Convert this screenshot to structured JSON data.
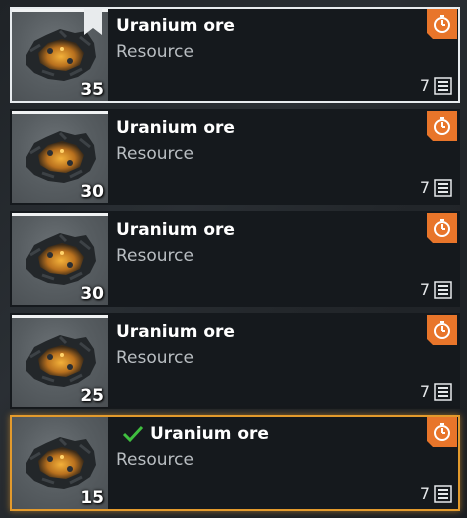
{
  "items": [
    {
      "name": "Uranium ore",
      "type": "Resource",
      "count": "35",
      "qty": "7",
      "selected": true,
      "bookmarked": true,
      "checked": false,
      "highlight": false
    },
    {
      "name": "Uranium ore",
      "type": "Resource",
      "count": "30",
      "qty": "7",
      "selected": false,
      "bookmarked": false,
      "checked": false,
      "highlight": false
    },
    {
      "name": "Uranium ore",
      "type": "Resource",
      "count": "30",
      "qty": "7",
      "selected": false,
      "bookmarked": false,
      "checked": false,
      "highlight": false
    },
    {
      "name": "Uranium ore",
      "type": "Resource",
      "count": "25",
      "qty": "7",
      "selected": false,
      "bookmarked": false,
      "checked": false,
      "highlight": false
    },
    {
      "name": "Uranium ore",
      "type": "Resource",
      "count": "15",
      "qty": "7",
      "selected": false,
      "bookmarked": false,
      "checked": true,
      "highlight": true
    }
  ],
  "icons": {
    "item_image": "uranium-ore-icon",
    "timer": "stopwatch-icon",
    "quantity": "list-icon",
    "check": "checkmark-icon",
    "bookmark": "bookmark-icon"
  },
  "colors": {
    "accent_orange": "#e8752a",
    "highlight_border": "#e39a2c",
    "selected_border": "#e8ecef",
    "check_green": "#3fbf3f"
  }
}
